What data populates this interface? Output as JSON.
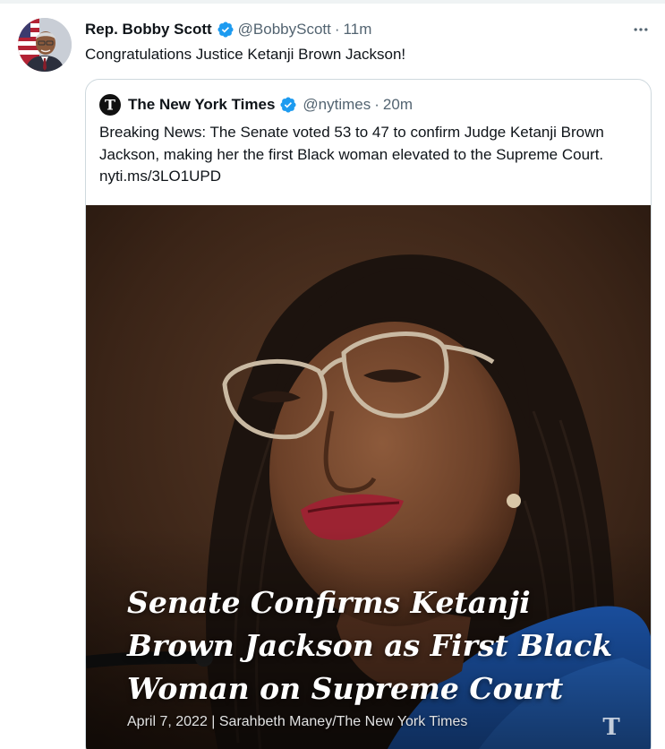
{
  "tweet": {
    "display_name": "Rep. Bobby Scott",
    "handle": "@BobbyScott",
    "separator": "·",
    "time": "11m",
    "text": "Congratulations Justice Ketanji Brown Jackson!",
    "more_icon": "more-horizontal-icon"
  },
  "quote": {
    "display_name": "The New York Times",
    "handle": "@nytimes",
    "separator": "·",
    "time": "20m",
    "text": "Breaking News: The Senate voted 53 to 47 to confirm Judge Ketanji Brown Jackson, making her the first Black woman elevated to the Supreme Court. nyti.ms/3LO1UPD",
    "media": {
      "headline_lines": [
        "Senate Confirms Ketanji",
        "Brown Jackson as First Black",
        "Woman on Supreme Court"
      ],
      "caption": "April 7, 2022 | Sarahbeth Maney/The New York Times"
    }
  },
  "colors": {
    "verified_blue": "#1d9bf0",
    "secondary_text": "#536471",
    "border": "#cfd9de"
  }
}
